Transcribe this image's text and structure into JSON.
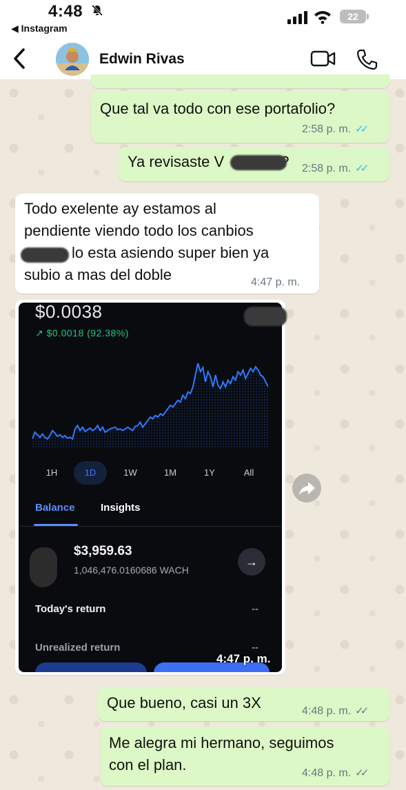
{
  "status_bar": {
    "time": "4:48",
    "back_app": "◀ Instagram",
    "battery": "22"
  },
  "header": {
    "contact_name": "Edwin Rivas"
  },
  "messages": [
    {
      "text": "Que tal va todo con ese portafolio?",
      "time": "2:58 p. m.",
      "ticks": "✓✓"
    },
    {
      "text": "Ya revisaste V",
      "text_after": "?",
      "time": "2:58 p. m.",
      "ticks": "✓✓"
    },
    {
      "lines": [
        "Todo exelente ay estamos al",
        "pendiente viendo todo los canbios",
        "lo esta asiendo super bien ya",
        "subio a mas del doble"
      ],
      "time": "4:47 p. m."
    },
    {
      "text": "Que bueno, casi un 3X",
      "time": "4:48 p. m.",
      "ticks": "✓✓"
    },
    {
      "lines": [
        "Me alegra mi hermano, seguimos",
        "con el plan."
      ],
      "time": "4:48 p. m.",
      "ticks": "✓✓"
    }
  ],
  "image_message": {
    "time": "4:47 p. m.",
    "screenshot": {
      "price": "$0.0038",
      "change": "↗ $0.0018 (92.38%)",
      "range_tabs": [
        "1H",
        "1D",
        "1W",
        "1M",
        "1Y",
        "All"
      ],
      "active_range": "1D",
      "segments": [
        "Balance",
        "Insights"
      ],
      "active_segment": "Balance",
      "holding_value": "$3,959.63",
      "holding_amount": "1,046,476.0160686 WACH",
      "rows": [
        {
          "label": "Today's return",
          "value": "--"
        },
        {
          "label": "Unrealized return",
          "value": "--"
        }
      ],
      "chart_series": [
        0.1,
        0.18,
        0.15,
        0.12,
        0.16,
        0.12,
        0.1,
        0.14,
        0.2,
        0.17,
        0.13,
        0.15,
        0.12,
        0.14,
        0.11,
        0.12,
        0.1,
        0.22,
        0.26,
        0.2,
        0.24,
        0.19,
        0.21,
        0.23,
        0.2,
        0.22,
        0.26,
        0.2,
        0.24,
        0.18,
        0.2,
        0.22,
        0.23,
        0.24,
        0.21,
        0.22,
        0.2,
        0.22,
        0.24,
        0.22,
        0.2,
        0.25,
        0.26,
        0.3,
        0.24,
        0.28,
        0.32,
        0.36,
        0.34,
        0.38,
        0.36,
        0.4,
        0.38,
        0.42,
        0.46,
        0.5,
        0.48,
        0.52,
        0.56,
        0.54,
        0.62,
        0.58,
        0.66,
        0.64,
        0.72,
        0.86,
        1.0,
        0.9,
        0.95,
        0.78,
        0.9,
        0.84,
        0.72,
        0.86,
        0.74,
        0.7,
        0.78,
        0.72,
        0.8,
        0.76,
        0.84,
        0.8,
        0.9,
        0.86,
        0.92,
        0.82,
        0.88,
        0.94,
        0.9,
        0.96,
        0.92,
        0.86,
        0.84,
        0.78,
        0.72
      ]
    }
  },
  "colors": {
    "outgoing_bubble": "#dcf8c6",
    "incoming_bubble": "#ffffff",
    "read_ticks": "#34b7f1",
    "chart_line": "#2f7bff",
    "positive_change": "#1ec97e"
  },
  "icons": {
    "back": "chevron-left-icon",
    "video": "video-camera-icon",
    "phone": "phone-icon",
    "forward": "forward-arrow-icon",
    "bell_off": "bell-slash-icon"
  }
}
